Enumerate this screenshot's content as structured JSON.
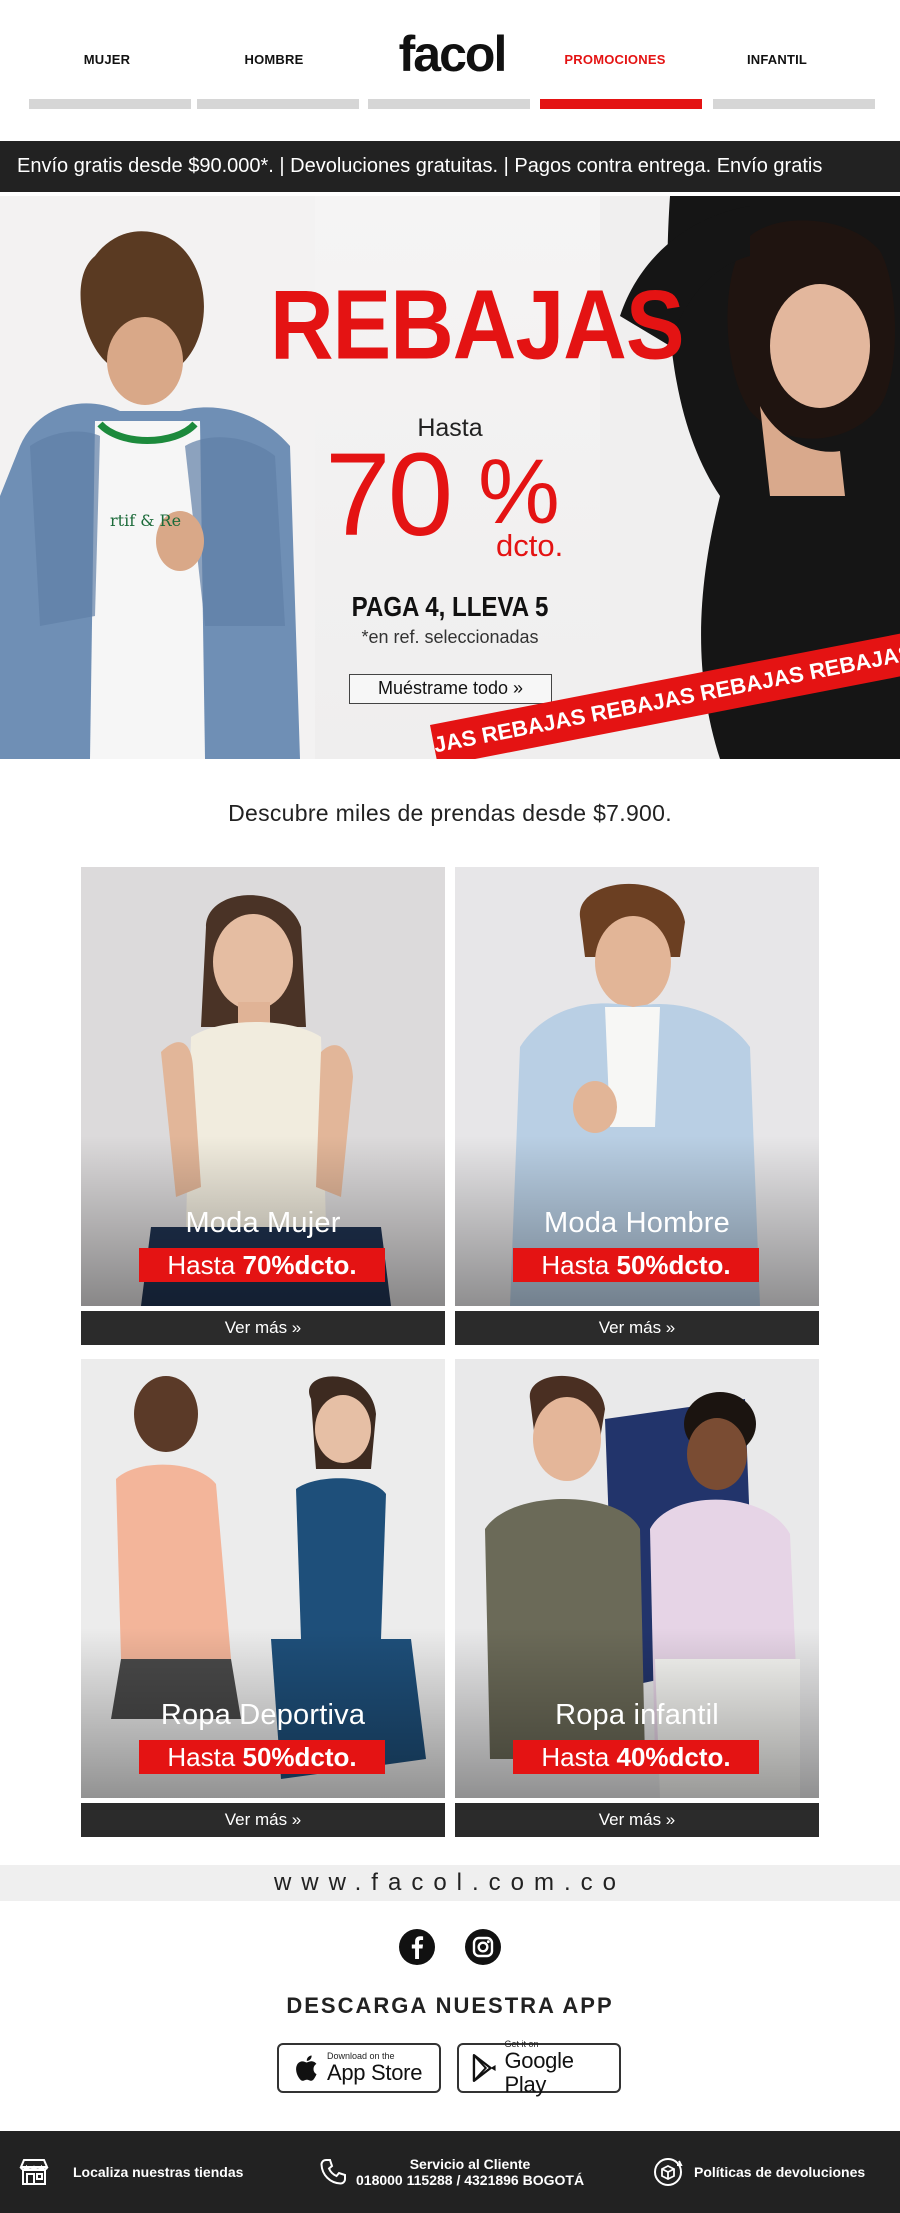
{
  "header": {
    "logo": "facol",
    "nav": [
      {
        "label": "MUJER",
        "active": false
      },
      {
        "label": "HOMBRE",
        "active": false
      },
      {
        "label": "",
        "active": false
      },
      {
        "label": "PROMOCIONES",
        "active": true
      },
      {
        "label": "INFANTIL",
        "active": false
      }
    ]
  },
  "ticker": {
    "text": "Envío gratis desde $90.000*.  |  Devoluciones gratuitas.  |  Pagos contra entrega.  Envío gratis"
  },
  "hero": {
    "title": "REBAJAS",
    "hasta": "Hasta",
    "percent": "70",
    "percent_sign": "%",
    "dcto": "dcto.",
    "offer": "PAGA 4, LLEVA 5",
    "note": "*en ref. seleccionadas",
    "cta": "Muéstrame todo »",
    "ribbon": "JAS REBAJAS REBAJAS REBAJAS REBAJAS"
  },
  "tagline": "Descubre miles de prendas desde $7.900.",
  "cards": [
    {
      "title": "Moda Mujer",
      "badge_prefix": "Hasta ",
      "badge_value": "70%dcto.",
      "button": "Ver más »"
    },
    {
      "title": "Moda Hombre",
      "badge_prefix": "Hasta ",
      "badge_value": "50%dcto.",
      "button": "Ver más »"
    },
    {
      "title": "Ropa Deportiva",
      "badge_prefix": "Hasta ",
      "badge_value": "50%dcto.",
      "button": "Ver más »"
    },
    {
      "title": "Ropa infantil",
      "badge_prefix": "Hasta ",
      "badge_value": "40%dcto.",
      "button": "Ver más »"
    }
  ],
  "footer": {
    "url": "www.facol.com.co",
    "app_title": "DESCARGA NUESTRA APP",
    "app_store_small": "Download on the",
    "app_store_big": "App Store",
    "google_small": "Get it on",
    "google_big": "Google Play",
    "stores_label": "Localiza nuestras tiendas",
    "service_title": "Servicio al Cliente",
    "service_phone": "018000 115288 / 4321896 BOGOTÁ",
    "returns_label": "Políticas de devoluciones"
  },
  "colors": {
    "accent": "#e41313",
    "dark": "#222222",
    "nav_bar": "#d6d6d6"
  },
  "icons": [
    "facebook-icon",
    "instagram-icon",
    "apple-icon",
    "google-play-icon",
    "store-icon",
    "phone-icon",
    "returns-box-icon"
  ]
}
